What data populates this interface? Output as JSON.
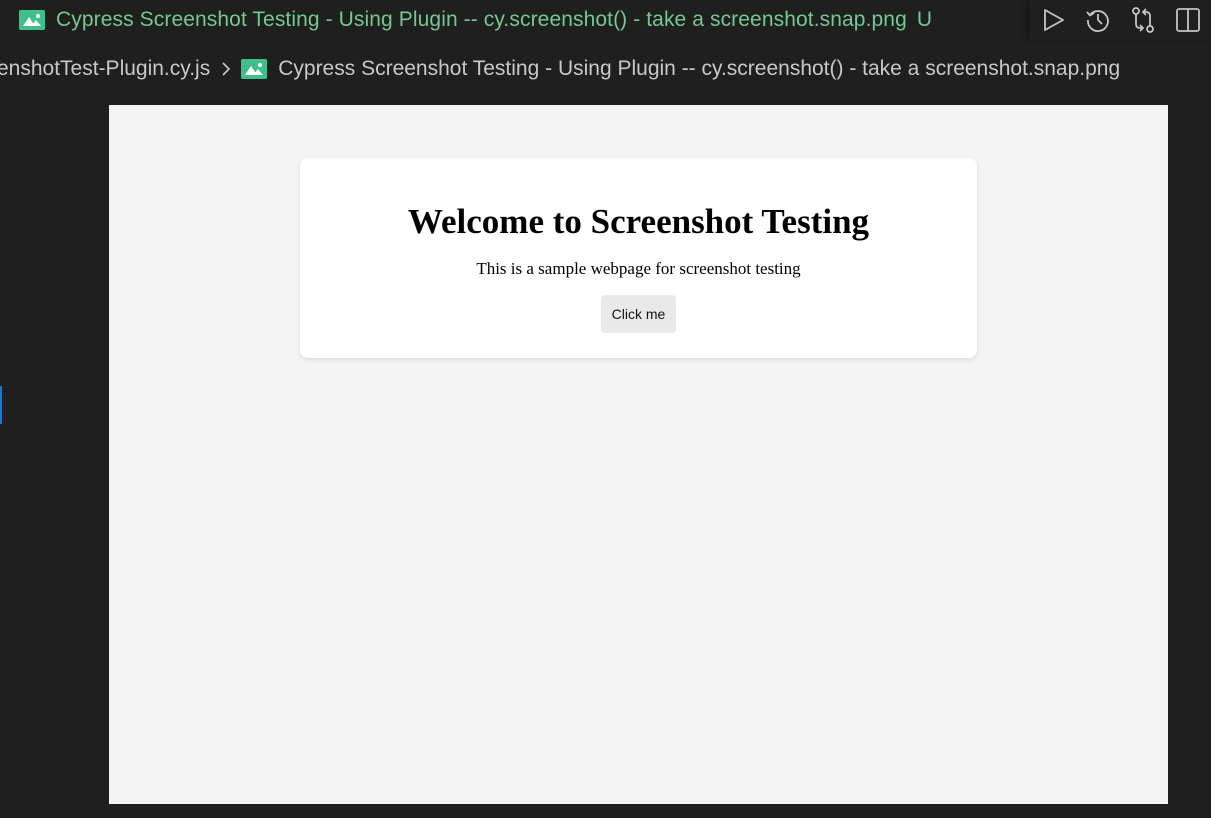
{
  "editor": {
    "tab": {
      "icon": "image-file-icon",
      "title": "Cypress Screenshot Testing - Using Plugin -- cy.screenshot() - take a screenshot.snap.png",
      "status": "U",
      "status_color": "#73c991"
    },
    "actions": [
      {
        "name": "run",
        "icon": "play-icon"
      },
      {
        "name": "timeline",
        "icon": "history-icon"
      },
      {
        "name": "open-changes",
        "icon": "compare-changes-icon"
      },
      {
        "name": "split-editor",
        "icon": "split-editor-icon"
      }
    ],
    "breadcrumb": {
      "items": [
        "enshotTest-Plugin.cy.js",
        "Cypress Screenshot Testing - Using Plugin -- cy.screenshot() - take a screenshot.snap.png"
      ],
      "separator_icon": "chevron-right-icon"
    }
  },
  "preview": {
    "heading": "Welcome to Screenshot Testing",
    "paragraph": "This is a sample webpage for screenshot testing",
    "button_label": "Click me"
  }
}
